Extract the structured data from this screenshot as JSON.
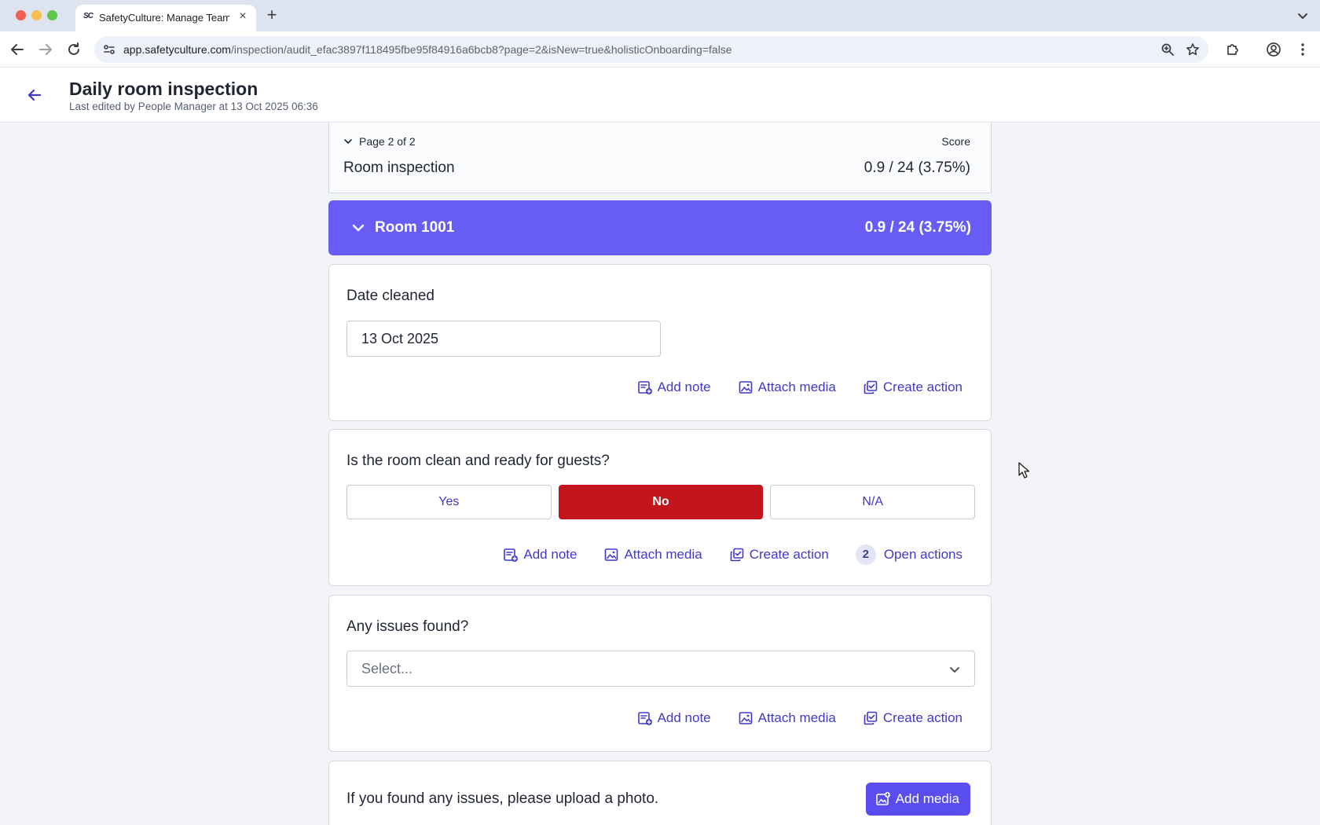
{
  "browser": {
    "tab_title": "SafetyCulture: Manage Teams",
    "tab_favicon": "SC",
    "url_host": "app.safetyculture.com",
    "url_path": "/inspection/audit_efac3897f118495fbe95f84916a6bcb8?page=2&isNew=true&holisticOnboarding=false"
  },
  "header": {
    "title": "Daily room inspection",
    "subtitle": "Last edited by People Manager at 13 Oct 2025 06:36"
  },
  "page_card": {
    "page_indicator": "Page 2 of 2",
    "score_label": "Score",
    "section_name": "Room inspection",
    "score_value": "0.9 / 24 (3.75%)"
  },
  "section": {
    "title": "Room 1001",
    "score": "0.9 / 24 (3.75%)"
  },
  "questions": {
    "date_cleaned": {
      "label": "Date cleaned",
      "value": "13 Oct 2025"
    },
    "room_clean": {
      "label": "Is the room clean and ready for guests?",
      "options": [
        "Yes",
        "No",
        "N/A"
      ],
      "selected": "No",
      "open_actions_count": "2",
      "open_actions_label": "Open actions"
    },
    "issues_found": {
      "label": "Any issues found?",
      "placeholder": "Select..."
    },
    "photo": {
      "label": "If you found any issues, please upload a photo.",
      "button": "Add media"
    }
  },
  "actions": {
    "add_note": "Add note",
    "attach_media": "Attach media",
    "create_action": "Create action"
  },
  "colors": {
    "section_header": "#675df4",
    "selected_no": "#c4151f",
    "link": "#4039c8",
    "primary_button": "#5a4df0"
  }
}
